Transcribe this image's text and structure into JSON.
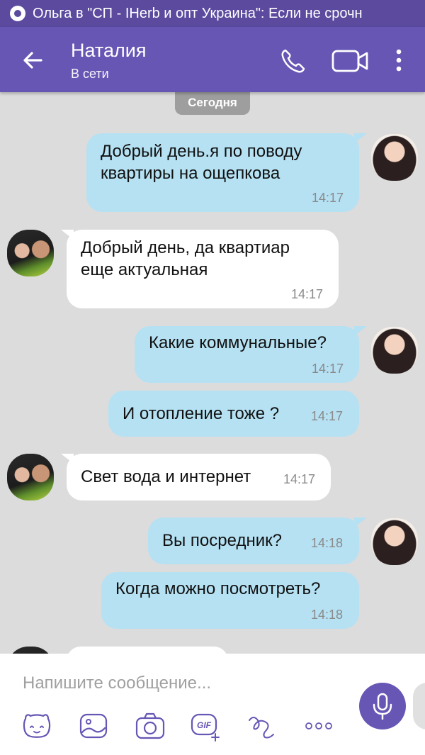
{
  "status_bar": {
    "notification_text": "Ольга в \"СП - IHerb и опт Украина\": Если не срочн"
  },
  "header": {
    "contact_name": "Наталия",
    "contact_status": "В сети"
  },
  "date_separator": "Сегодня",
  "messages": [
    {
      "direction": "out",
      "text": "Добрый день.я по поводу квартиры на ощепкова",
      "time": "14:17"
    },
    {
      "direction": "in",
      "text": "Добрый день, да квартиар еще актуальная",
      "time": "14:17"
    },
    {
      "direction": "out",
      "text": "Какие коммунальные?",
      "time": "14:17"
    },
    {
      "direction": "out",
      "text": "И отопление тоже ?",
      "time": "14:17"
    },
    {
      "direction": "in",
      "text": "Свет вода и интернет",
      "time": "14:17"
    },
    {
      "direction": "out",
      "text": "Вы посредник?",
      "time": "14:18"
    },
    {
      "direction": "out",
      "text": "Когда можно посмотреть?",
      "time": "14:18"
    }
  ],
  "composer": {
    "placeholder": "Напишите сообщение...",
    "gif_label": "GIF"
  },
  "colors": {
    "status_bar": "#5b4a9e",
    "header": "#6756b4",
    "outgoing_bubble": "#b5e1f3",
    "incoming_bubble": "#ffffff",
    "background": "#dcdcdc"
  },
  "icons": [
    "back-arrow-icon",
    "phone-icon",
    "video-camera-icon",
    "more-vert-icon",
    "microphone-icon",
    "sticker-icon",
    "gallery-icon",
    "camera-icon",
    "gif-icon",
    "doodle-icon",
    "more-horiz-icon"
  ]
}
